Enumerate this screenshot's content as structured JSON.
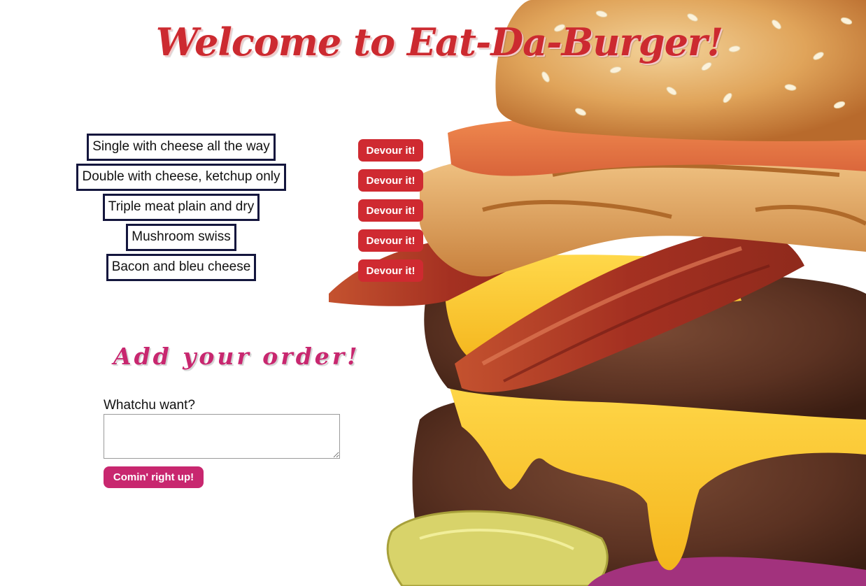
{
  "header": {
    "title": "Welcome to Eat-Da-Burger!"
  },
  "burgers": [
    {
      "name": "Single with cheese all the way",
      "action_label": "Devour it!"
    },
    {
      "name": "Double with cheese, ketchup only",
      "action_label": "Devour it!"
    },
    {
      "name": "Triple meat plain and dry",
      "action_label": "Devour it!"
    },
    {
      "name": "Mushroom swiss",
      "action_label": "Devour it!"
    },
    {
      "name": "Bacon and bleu cheese",
      "action_label": "Devour it!"
    }
  ],
  "order_form": {
    "heading": "Add your order!",
    "label": "Whatchu want?",
    "value": "",
    "submit_label": "Comin' right up!"
  },
  "colors": {
    "title": "#cc2a30",
    "devour_button": "#cf2a31",
    "order_accent": "#c8276f",
    "burger_border": "#14163d"
  },
  "background_image": "burger-photo"
}
